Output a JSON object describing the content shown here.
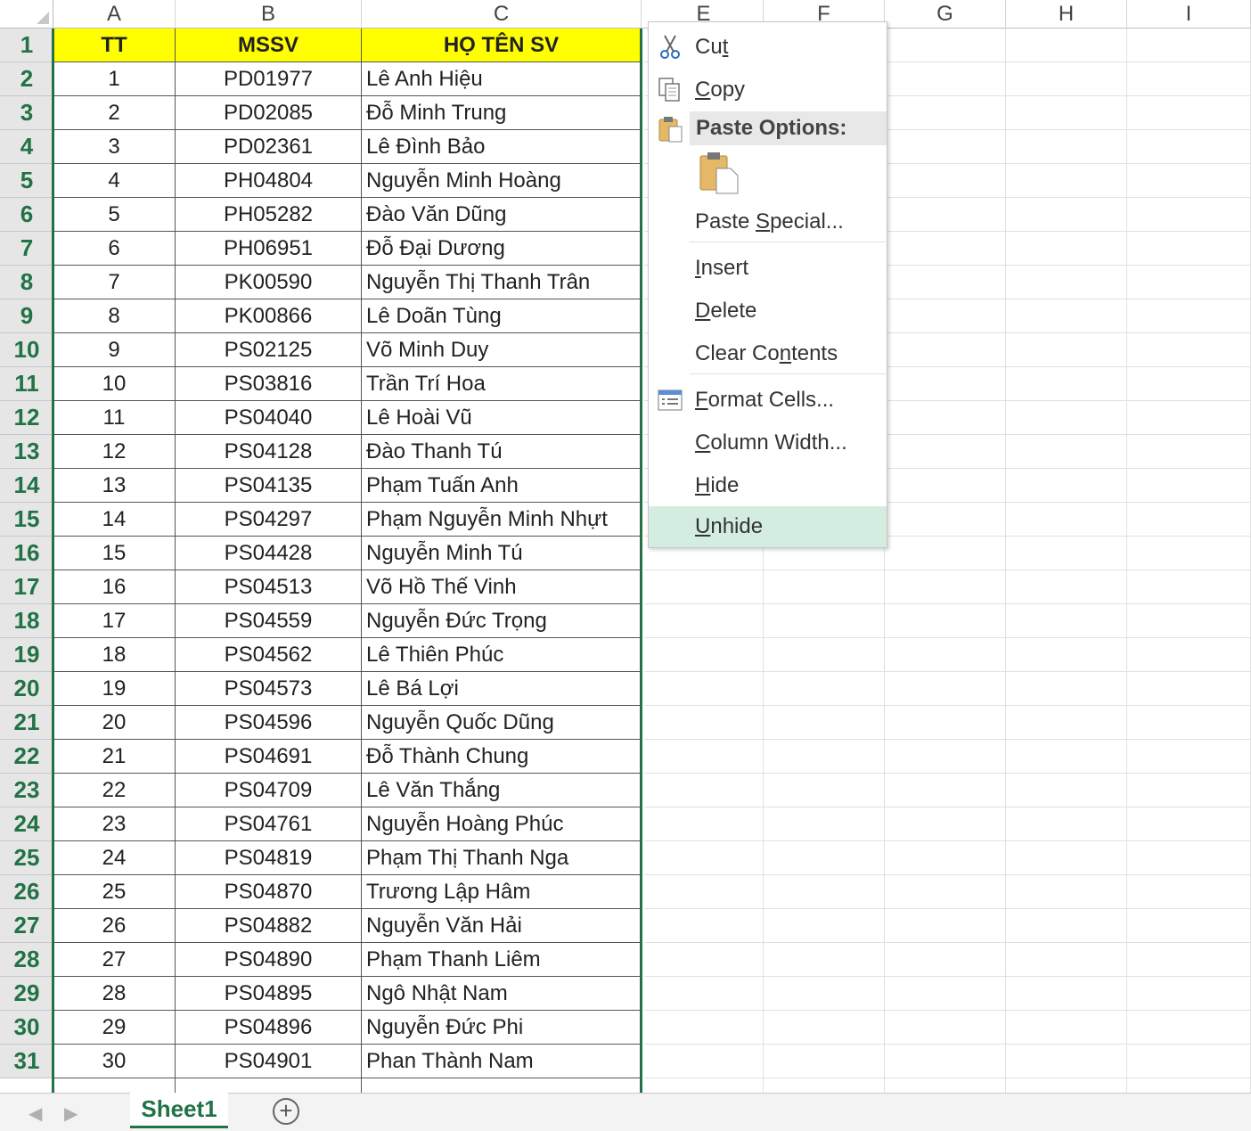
{
  "columns": [
    "A",
    "B",
    "C",
    "E",
    "F",
    "G",
    "H",
    "I"
  ],
  "row_numbers": [
    "1",
    "2",
    "3",
    "4",
    "5",
    "6",
    "7",
    "8",
    "9",
    "10",
    "11",
    "12",
    "13",
    "14",
    "15",
    "16",
    "17",
    "18",
    "19",
    "20",
    "21",
    "22",
    "23",
    "24",
    "25",
    "26",
    "27",
    "28",
    "29",
    "30",
    "31"
  ],
  "header": {
    "tt": "TT",
    "mssv": "MSSV",
    "name": "HỌ TÊN SV"
  },
  "rows": [
    [
      "1",
      "PD01977",
      "Lê Anh Hiệu"
    ],
    [
      "2",
      "PD02085",
      "Đỗ Minh Trung"
    ],
    [
      "3",
      "PD02361",
      "Lê Đình Bảo"
    ],
    [
      "4",
      "PH04804",
      "Nguyễn Minh Hoàng"
    ],
    [
      "5",
      "PH05282",
      "Đào Văn Dũng"
    ],
    [
      "6",
      "PH06951",
      "Đỗ Đại Dương"
    ],
    [
      "7",
      "PK00590",
      "Nguyễn Thị Thanh Trân"
    ],
    [
      "8",
      "PK00866",
      "Lê Doãn Tùng"
    ],
    [
      "9",
      "PS02125",
      "Võ Minh Duy"
    ],
    [
      "10",
      "PS03816",
      "Trần Trí Hoa"
    ],
    [
      "11",
      "PS04040",
      "Lê Hoài Vũ"
    ],
    [
      "12",
      "PS04128",
      "Đào Thanh Tú"
    ],
    [
      "13",
      "PS04135",
      "Phạm Tuấn Anh"
    ],
    [
      "14",
      "PS04297",
      "Phạm Nguyễn Minh Nhựt"
    ],
    [
      "15",
      "PS04428",
      "Nguyễn Minh Tú"
    ],
    [
      "16",
      "PS04513",
      "Võ Hồ Thế Vinh"
    ],
    [
      "17",
      "PS04559",
      "Nguyễn Đức Trọng"
    ],
    [
      "18",
      "PS04562",
      "Lê Thiên Phúc"
    ],
    [
      "19",
      "PS04573",
      "Lê Bá Lợi"
    ],
    [
      "20",
      "PS04596",
      "Nguyễn Quốc Dũng"
    ],
    [
      "21",
      "PS04691",
      "Đỗ Thành Chung"
    ],
    [
      "22",
      "PS04709",
      "Lê Văn Thắng"
    ],
    [
      "23",
      "PS04761",
      "Nguyễn Hoàng Phúc"
    ],
    [
      "24",
      "PS04819",
      "Phạm Thị Thanh Nga"
    ],
    [
      "25",
      "PS04870",
      "Trương Lập Hâm"
    ],
    [
      "26",
      "PS04882",
      "Nguyễn Văn Hải"
    ],
    [
      "27",
      "PS04890",
      "Phạm Thanh Liêm"
    ],
    [
      "28",
      "PS04895",
      "Ngô Nhật Nam"
    ],
    [
      "29",
      "PS04896",
      "Nguyễn Đức Phi"
    ],
    [
      "30",
      "PS04901",
      "Phan Thành Nam"
    ]
  ],
  "context_menu": {
    "cut": {
      "pre": "Cu",
      "key": "t",
      "post": ""
    },
    "copy": {
      "pre": "",
      "key": "C",
      "post": "opy"
    },
    "paste_options": "Paste Options:",
    "paste_special": {
      "pre": "Paste ",
      "key": "S",
      "post": "pecial..."
    },
    "insert": {
      "pre": "",
      "key": "I",
      "post": "nsert"
    },
    "delete": {
      "pre": "",
      "key": "D",
      "post": "elete"
    },
    "clear_contents": {
      "pre": "Clear Co",
      "key": "n",
      "post": "tents"
    },
    "format_cells": {
      "pre": "",
      "key": "F",
      "post": "ormat Cells..."
    },
    "column_width": {
      "pre": "",
      "key": "C",
      "post": "olumn Width..."
    },
    "hide": {
      "pre": "",
      "key": "H",
      "post": "ide"
    },
    "unhide": {
      "pre": "",
      "key": "U",
      "post": "nhide"
    },
    "highlighted": "unhide"
  },
  "sheet_tabs": {
    "active": "Sheet1",
    "add_icon": "plus-circle-icon"
  },
  "colors": {
    "accent": "#217346",
    "header_fill": "#ffff00",
    "menu_highlight": "#d4ede1"
  }
}
